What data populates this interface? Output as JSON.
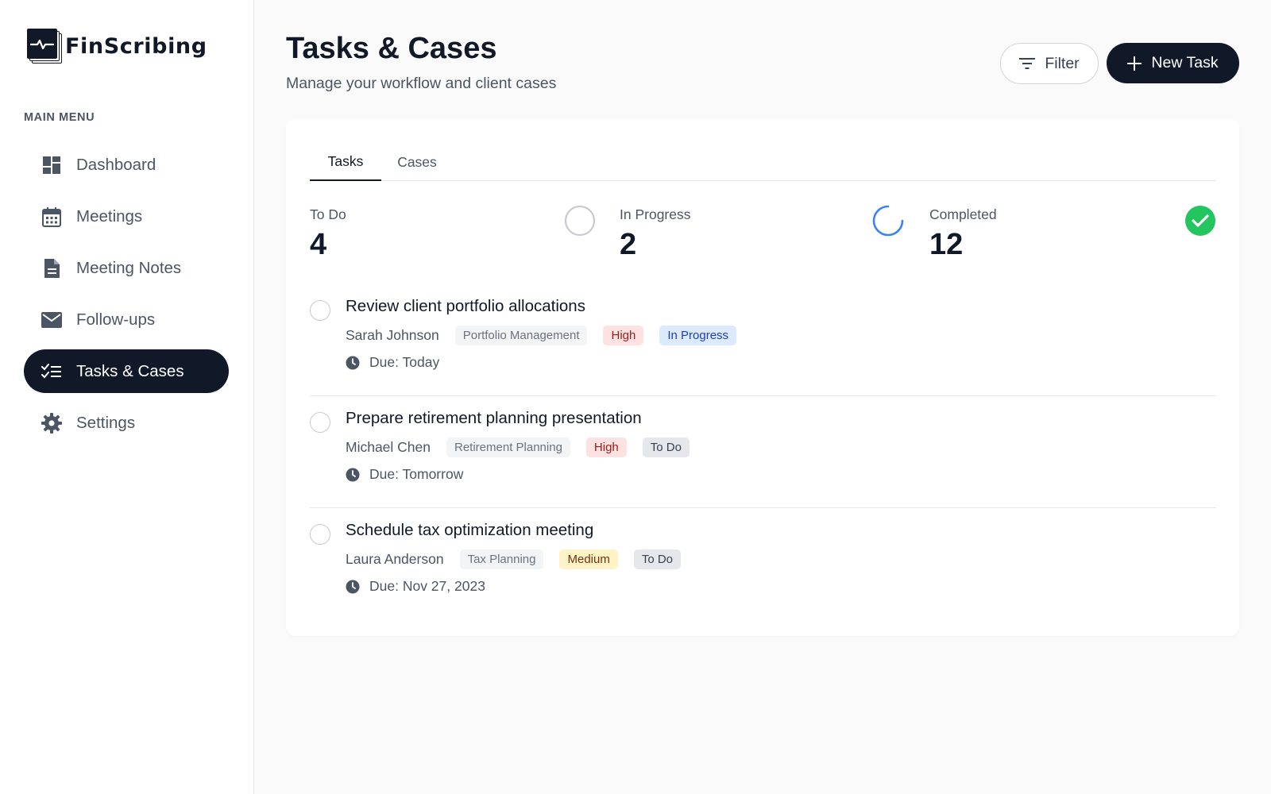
{
  "brand": {
    "name": "FinScribing"
  },
  "sidebar": {
    "heading": "MAIN MENU",
    "items": [
      {
        "label": "Dashboard",
        "icon": "dashboard-icon",
        "active": false
      },
      {
        "label": "Meetings",
        "icon": "calendar-icon",
        "active": false
      },
      {
        "label": "Meeting Notes",
        "icon": "document-icon",
        "active": false
      },
      {
        "label": "Follow-ups",
        "icon": "mail-icon",
        "active": false
      },
      {
        "label": "Tasks & Cases",
        "icon": "checklist-icon",
        "active": true
      },
      {
        "label": "Settings",
        "icon": "gear-icon",
        "active": false
      }
    ]
  },
  "header": {
    "title": "Tasks & Cases",
    "subtitle": "Manage your workflow and client cases",
    "filter_label": "Filter",
    "new_task_label": "New Task"
  },
  "tabs": [
    {
      "label": "Tasks",
      "active": true
    },
    {
      "label": "Cases",
      "active": false
    }
  ],
  "stats": {
    "todo": {
      "label": "To Do",
      "value": "4",
      "icon": "empty-circle-icon"
    },
    "in_progress": {
      "label": "In Progress",
      "value": "2",
      "icon": "spinner-icon"
    },
    "completed": {
      "label": "Completed",
      "value": "12",
      "icon": "check-circle-icon"
    }
  },
  "tasks": [
    {
      "title": "Review client portfolio allocations",
      "client": "Sarah Johnson",
      "category": "Portfolio Management",
      "priority": "High",
      "status": "In Progress",
      "due": "Due: Today"
    },
    {
      "title": "Prepare retirement planning presentation",
      "client": "Michael Chen",
      "category": "Retirement Planning",
      "priority": "High",
      "status": "To Do",
      "due": "Due: Tomorrow"
    },
    {
      "title": "Schedule tax optimization meeting",
      "client": "Laura Anderson",
      "category": "Tax Planning",
      "priority": "Medium",
      "status": "To Do",
      "due": "Due: Nov 27, 2023"
    }
  ],
  "colors": {
    "primary": "#111827",
    "success": "#22c55e",
    "progress": "#3b82f6",
    "high_bg": "#fee2e2",
    "medium_bg": "#fef3c7",
    "in_progress_bg": "#dbeafe"
  }
}
